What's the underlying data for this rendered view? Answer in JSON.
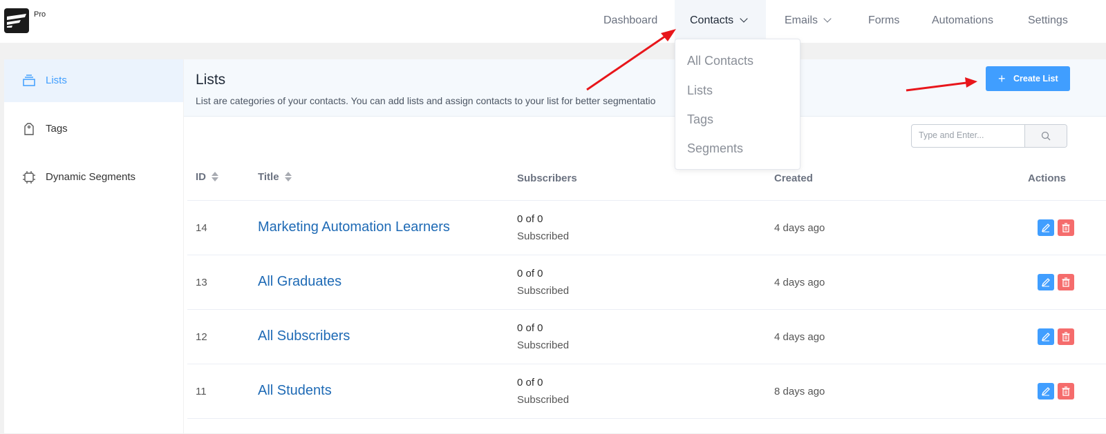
{
  "app": {
    "badge": "Pro"
  },
  "nav": {
    "items": [
      {
        "label": "Dashboard"
      },
      {
        "label": "Contacts"
      },
      {
        "label": "Emails"
      },
      {
        "label": "Forms"
      },
      {
        "label": "Automations"
      },
      {
        "label": "Settings"
      }
    ],
    "active": "Contacts"
  },
  "contacts_dropdown": [
    "All Contacts",
    "Lists",
    "Tags",
    "Segments"
  ],
  "sidebar": {
    "items": [
      {
        "label": "Lists",
        "icon": "stack-icon",
        "active": true
      },
      {
        "label": "Tags",
        "icon": "tag-icon",
        "active": false
      },
      {
        "label": "Dynamic Segments",
        "icon": "chip-icon",
        "active": false
      }
    ]
  },
  "page": {
    "title": "Lists",
    "subtitle": "List are categories of your contacts. You can add lists and assign contacts to your list for better segmentatio",
    "create_label": "Create List",
    "search_placeholder": "Type and Enter..."
  },
  "table": {
    "headers": {
      "id": "ID",
      "title": "Title",
      "subscribers": "Subscribers",
      "created": "Created",
      "actions": "Actions"
    },
    "rows": [
      {
        "id": "14",
        "title": "Marketing Automation Learners",
        "subs": "0 of 0",
        "subs_label": "Subscribed",
        "created": "4 days ago"
      },
      {
        "id": "13",
        "title": "All Graduates",
        "subs": "0 of 0",
        "subs_label": "Subscribed",
        "created": "4 days ago"
      },
      {
        "id": "12",
        "title": "All Subscribers",
        "subs": "0 of 0",
        "subs_label": "Subscribed",
        "created": "4 days ago"
      },
      {
        "id": "11",
        "title": "All Students",
        "subs": "0 of 0",
        "subs_label": "Subscribed",
        "created": "8 days ago"
      }
    ]
  },
  "colors": {
    "primary": "#409eff",
    "danger": "#f56c6c",
    "link": "#1e6ab5",
    "annotation_arrow": "#e8161b"
  }
}
